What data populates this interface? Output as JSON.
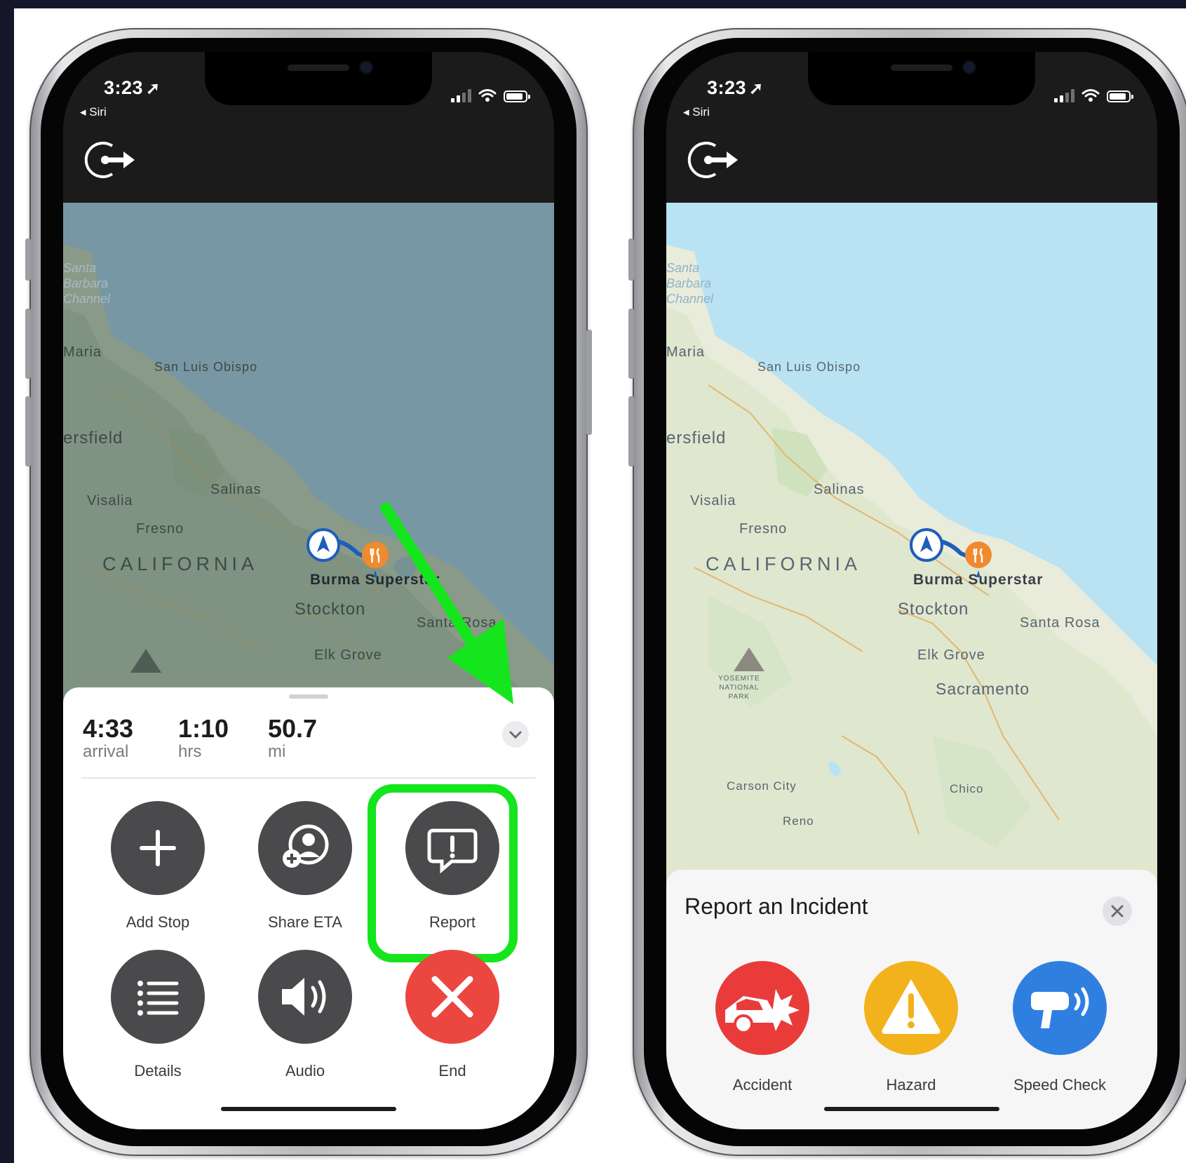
{
  "colors": {
    "page_background": "#16162a",
    "accent_green": "#14e51c",
    "button_dark": "#4a4a4d",
    "end_red": "#ec4640",
    "accident_red": "#ea3b3b",
    "hazard_yellow": "#f2b21b",
    "speed_check_blue": "#2f7fe0",
    "water_dark": "#7897a5",
    "water_light": "#b9e3f3"
  },
  "left_phone": {
    "status": {
      "time": "3:23",
      "location_icon": "location-arrow-icon",
      "back_label": "◂ Siri"
    },
    "map": {
      "labels": {
        "santa_barbara_channel": "Santa\nBarbara\nChannel",
        "santa_maria": "Maria",
        "san_luis_obispo": "San Luis Obispo",
        "bakersfield": "ersfield",
        "salinas": "Salinas",
        "visalia": "Visalia",
        "fresno": "Fresno",
        "california": "CALIFORNIA",
        "destination": "Burma Superstar",
        "stockton": "Stockton",
        "santa_rosa": "Santa Rosa",
        "elk_grove": "Elk Grove"
      }
    },
    "trip": {
      "arrival_value": "4:33",
      "arrival_unit": "arrival",
      "duration_value": "1:10",
      "duration_unit": "hrs",
      "distance_value": "50.7",
      "distance_unit": "mi"
    },
    "actions": {
      "add_stop": "Add Stop",
      "share_eta": "Share ETA",
      "report": "Report",
      "details": "Details",
      "audio": "Audio",
      "end": "End"
    }
  },
  "right_phone": {
    "status": {
      "time": "3:23",
      "location_icon": "location-arrow-icon",
      "back_label": "◂ Siri"
    },
    "map": {
      "labels": {
        "santa_barbara_channel": "Santa\nBarbara\nChannel",
        "santa_maria": "Maria",
        "san_luis_obispo": "San Luis Obispo",
        "bakersfield": "ersfield",
        "salinas": "Salinas",
        "visalia": "Visalia",
        "fresno": "Fresno",
        "california": "CALIFORNIA",
        "destination": "Burma Superstar",
        "stockton": "Stockton",
        "santa_rosa": "Santa Rosa",
        "elk_grove": "Elk Grove",
        "yosemite": "YOSEMITE\nNATIONAL\nPARK",
        "sacramento": "Sacramento",
        "carson_city": "Carson City",
        "chico": "Chico",
        "reno": "Reno"
      }
    },
    "report_sheet": {
      "title": "Report an Incident",
      "options": {
        "accident": "Accident",
        "hazard": "Hazard",
        "speed_check": "Speed Check"
      }
    }
  }
}
